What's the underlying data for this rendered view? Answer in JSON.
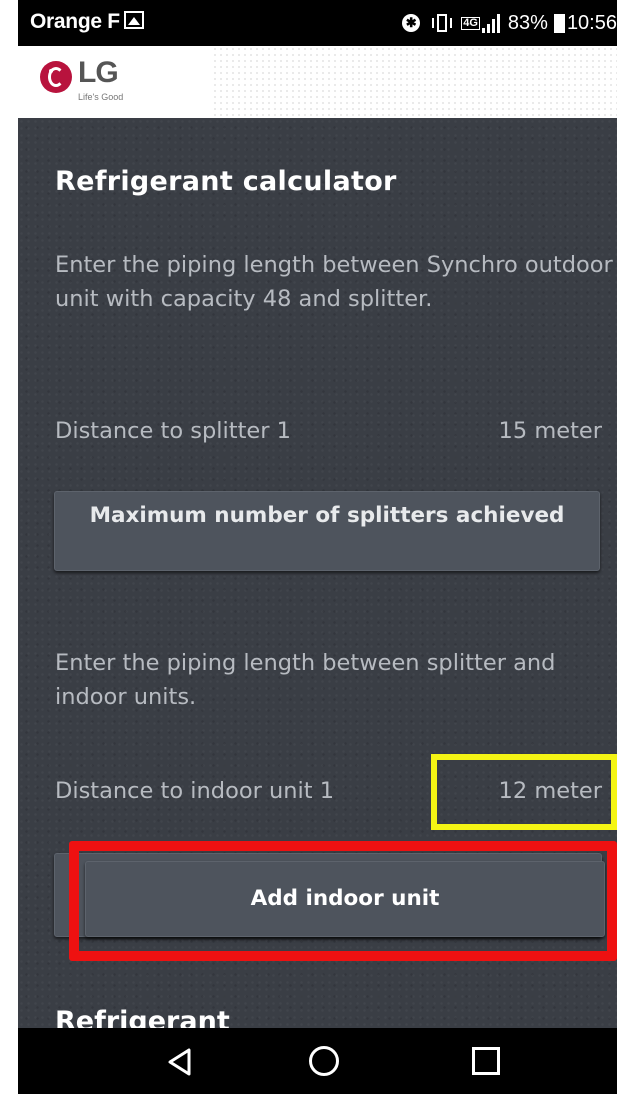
{
  "status_bar": {
    "carrier": "Orange F",
    "network_type": "4G",
    "battery": "83%",
    "time": "10:56",
    "icons": [
      "gallery-icon",
      "bluetooth-icon",
      "vibrate-icon",
      "network-4g-icon",
      "signal-icon",
      "battery-icon"
    ]
  },
  "logo": {
    "brand": "LG",
    "tagline": "Life's Good",
    "brand_color": "#b8133d"
  },
  "calculator": {
    "title": "Refrigerant calculator",
    "instruction_outdoor": "Enter the piping length between Synchro outdoor unit with capacity 48 and splitter.",
    "splitter_row": {
      "label": "Distance to splitter 1",
      "value": "15 meter"
    },
    "max_splitters_button": "Maximum number of splitters achieved",
    "instruction_indoor": "Enter the piping length between splitter and indoor units.",
    "indoor_row": {
      "label": "Distance to indoor unit 1",
      "value": "12 meter"
    },
    "add_indoor_button": "Add indoor unit",
    "next_section_title": "Refrigerant"
  },
  "highlights": {
    "value_box_color": "#f5f514",
    "button_box_color": "#ee1111"
  },
  "nav_bar": {
    "icons": [
      "back-icon",
      "home-icon",
      "recents-icon"
    ]
  }
}
